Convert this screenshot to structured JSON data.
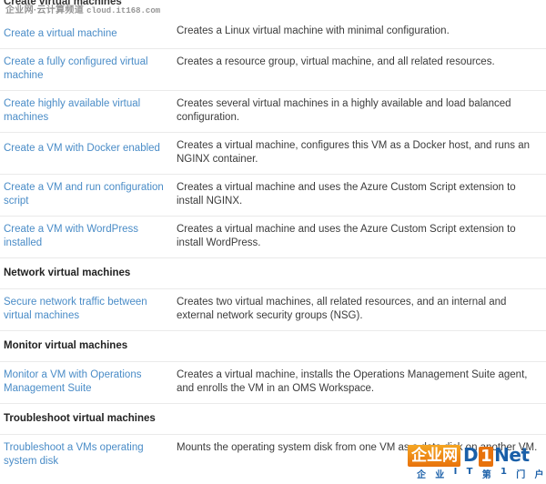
{
  "page": {
    "clipped_section_title": "Create virtual machines",
    "top_watermark": {
      "label": "企业网·云计算频道",
      "url": "cloud.it168.com"
    }
  },
  "table": {
    "rows": [
      {
        "type": "link",
        "link": "Create a virtual machine",
        "desc": "Creates a Linux virtual machine with minimal configuration."
      },
      {
        "type": "link",
        "link": "Create a fully configured virtual machine",
        "desc": "Creates a resource group, virtual machine, and all related resources."
      },
      {
        "type": "link",
        "link": "Create highly available virtual machines",
        "desc": "Creates several virtual machines in a highly available and load balanced configuration."
      },
      {
        "type": "link",
        "link": "Create a VM with Docker enabled",
        "desc": "Creates a virtual machine, configures this VM as a Docker host, and runs an NGINX container."
      },
      {
        "type": "link",
        "link": "Create a VM and run configuration script",
        "desc": "Creates a virtual machine and uses the Azure Custom Script extension to install NGINX."
      },
      {
        "type": "link",
        "link": "Create a VM with WordPress installed",
        "desc": "Creates a virtual machine and uses the Azure Custom Script extension to install WordPress."
      },
      {
        "type": "section",
        "title": "Network virtual machines"
      },
      {
        "type": "link",
        "link": "Secure network traffic between virtual machines",
        "desc": "Creates two virtual machines, all related resources, and an internal and external network security groups (NSG)."
      },
      {
        "type": "section",
        "title": "Monitor virtual machines"
      },
      {
        "type": "link",
        "link": "Monitor a VM with Operations Management Suite",
        "desc": "Creates a virtual machine, installs the Operations Management Suite agent, and enrolls the VM in an OMS Workspace."
      },
      {
        "type": "section",
        "title": "Troubleshoot virtual machines"
      },
      {
        "type": "link",
        "link": "Troubleshoot a VMs operating system disk",
        "desc": "Mounts the operating system disk from one VM as a data disk on another VM."
      }
    ]
  },
  "brand_watermark": {
    "cn_name": "企业网",
    "brand_d": "D",
    "brand_one": "1",
    "brand_net": "Net",
    "tagline": [
      "企",
      "业",
      "I",
      "T",
      "第",
      "1",
      "门",
      "户"
    ]
  },
  "colors": {
    "link": "#4a8cc7",
    "text": "#3b3b3b",
    "divider": "#eaeaea",
    "brand_orange": "#e8720c",
    "brand_blue": "#1a5fa8"
  }
}
